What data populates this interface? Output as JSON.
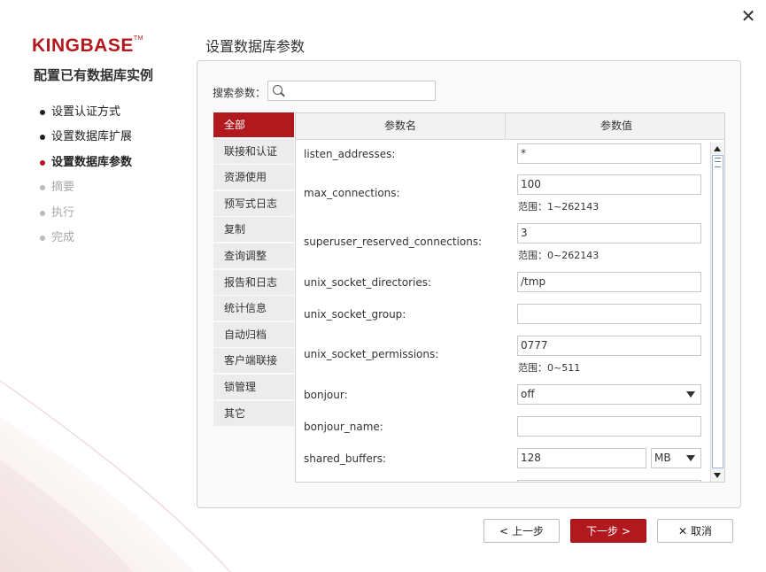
{
  "window": {
    "close_glyph": "✕"
  },
  "brand": {
    "logo_text": "KINGBASE",
    "logo_tm": "TM",
    "color": "#b2191e"
  },
  "left": {
    "title": "配置已有数据库实例",
    "steps": [
      {
        "label": "设置认证方式",
        "state": "done"
      },
      {
        "label": "设置数据库扩展",
        "state": "done"
      },
      {
        "label": "设置数据库参数",
        "state": "active"
      },
      {
        "label": "摘要",
        "state": "pending"
      },
      {
        "label": "执行",
        "state": "pending"
      },
      {
        "label": "完成",
        "state": "pending"
      }
    ]
  },
  "main": {
    "title": "设置数据库参数",
    "search": {
      "label": "搜索参数：",
      "value": "",
      "placeholder": ""
    },
    "categories": [
      "全部",
      "联接和认证",
      "资源使用",
      "预写式日志",
      "复制",
      "查询调整",
      "报告和日志",
      "统计信息",
      "自动归档",
      "客户端联接",
      "锁管理",
      "其它"
    ],
    "active_category": "全部",
    "columns": {
      "name": "参数名",
      "value": "参数值"
    },
    "params": [
      {
        "name": "listen_addresses:",
        "value": "*"
      },
      {
        "name": "max_connections:",
        "value": "100",
        "range": "范围：1~262143"
      },
      {
        "name": "superuser_reserved_connections:",
        "value": "3",
        "range": "范围：0~262143"
      },
      {
        "name": "unix_socket_directories:",
        "value": "/tmp"
      },
      {
        "name": "unix_socket_group:",
        "value": ""
      },
      {
        "name": "unix_socket_permissions:",
        "value": "0777",
        "range": "范围：0~511"
      },
      {
        "name": "bonjour:",
        "value": "off",
        "type": "select"
      },
      {
        "name": "bonjour_name:",
        "value": ""
      },
      {
        "name": "shared_buffers:",
        "value": "128",
        "unit": "MB"
      }
    ]
  },
  "footer": {
    "prev_label": "上一步",
    "next_label": "下一步",
    "cancel_label": "取消"
  }
}
